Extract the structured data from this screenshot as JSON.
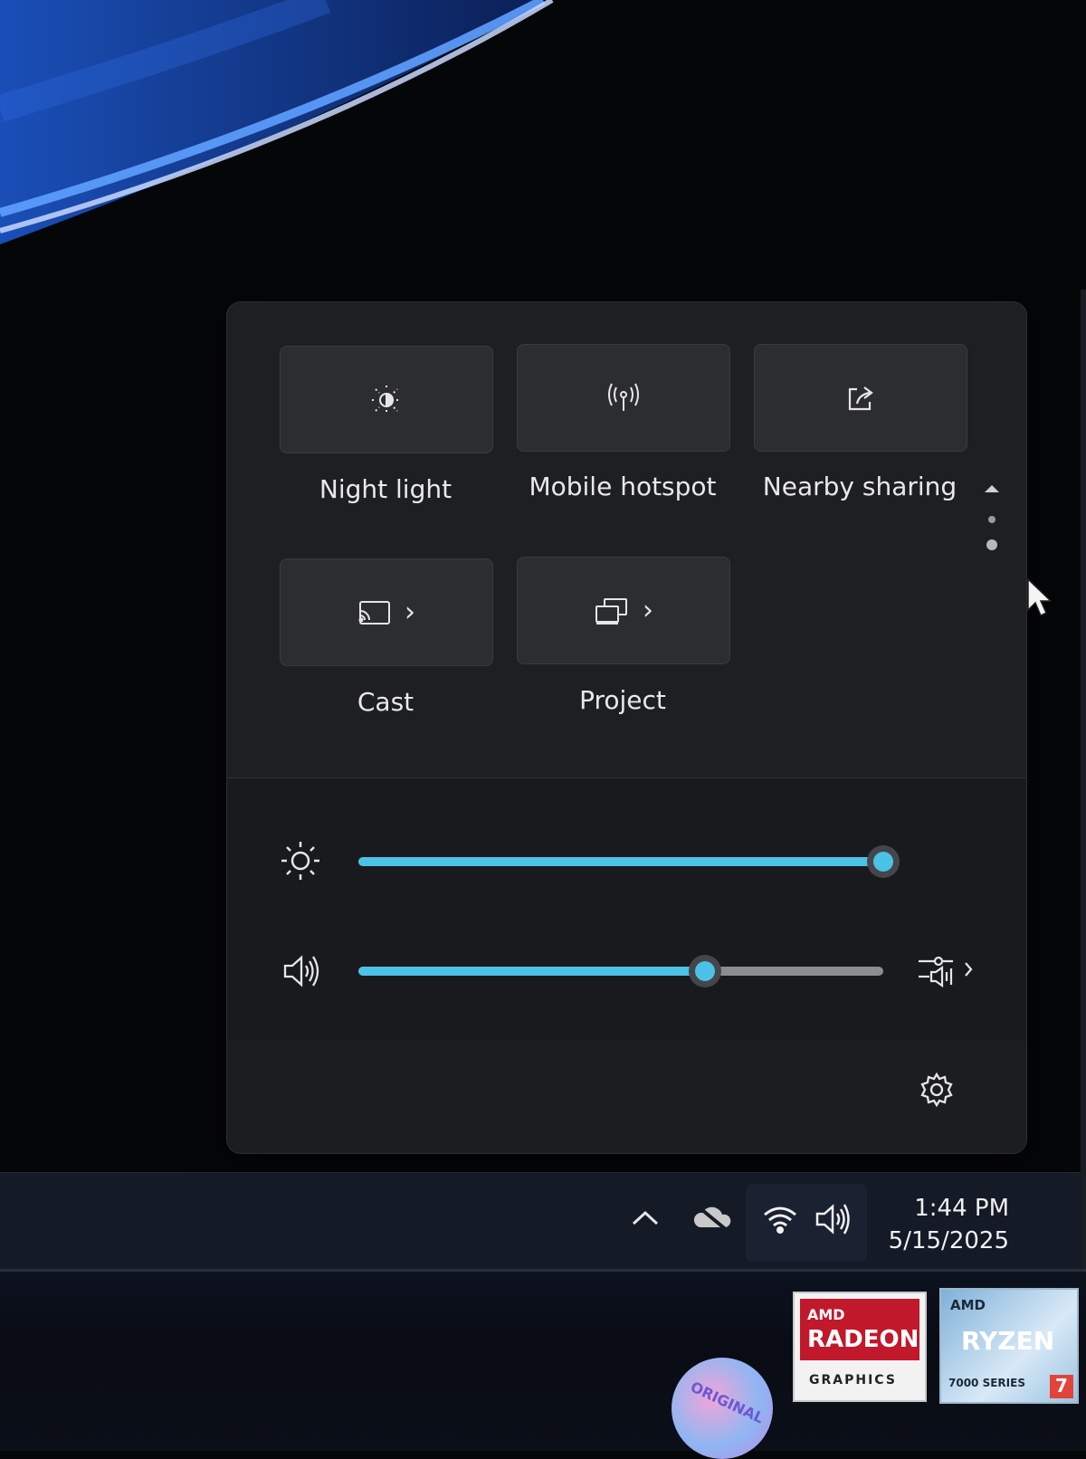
{
  "quick_settings": {
    "tiles": [
      {
        "label": "Night light",
        "icon": "night-light-icon"
      },
      {
        "label": "Mobile hotspot",
        "icon": "mobile-hotspot-icon"
      },
      {
        "label": "Nearby sharing",
        "icon": "nearby-sharing-icon"
      },
      {
        "label": "Cast",
        "icon": "cast-icon",
        "has_chevron": true
      },
      {
        "label": "Project",
        "icon": "project-icon",
        "has_chevron": true
      }
    ],
    "brightness": {
      "icon": "brightness-icon",
      "value": 1.0
    },
    "volume": {
      "icon": "speaker-icon",
      "value": 0.66
    },
    "footer": {
      "icon": "settings-gear-icon"
    },
    "accent_color": "#4cc2e6"
  },
  "taskbar": {
    "tray": [
      "chevron-up-icon",
      "onedrive-offline-icon",
      "wifi-icon",
      "speaker-icon"
    ],
    "time": "1:44 PM",
    "date": "5/15/2025"
  },
  "stickers": {
    "radeon": {
      "brand": "AMD",
      "line1": "RADEON",
      "line2": "GRAPHICS"
    },
    "ryzen": {
      "brand": "AMD",
      "line1": "RYZEN",
      "line2": "7000 SERIES",
      "tier": "7"
    },
    "holo": {
      "text": "ORIGINAL"
    }
  }
}
